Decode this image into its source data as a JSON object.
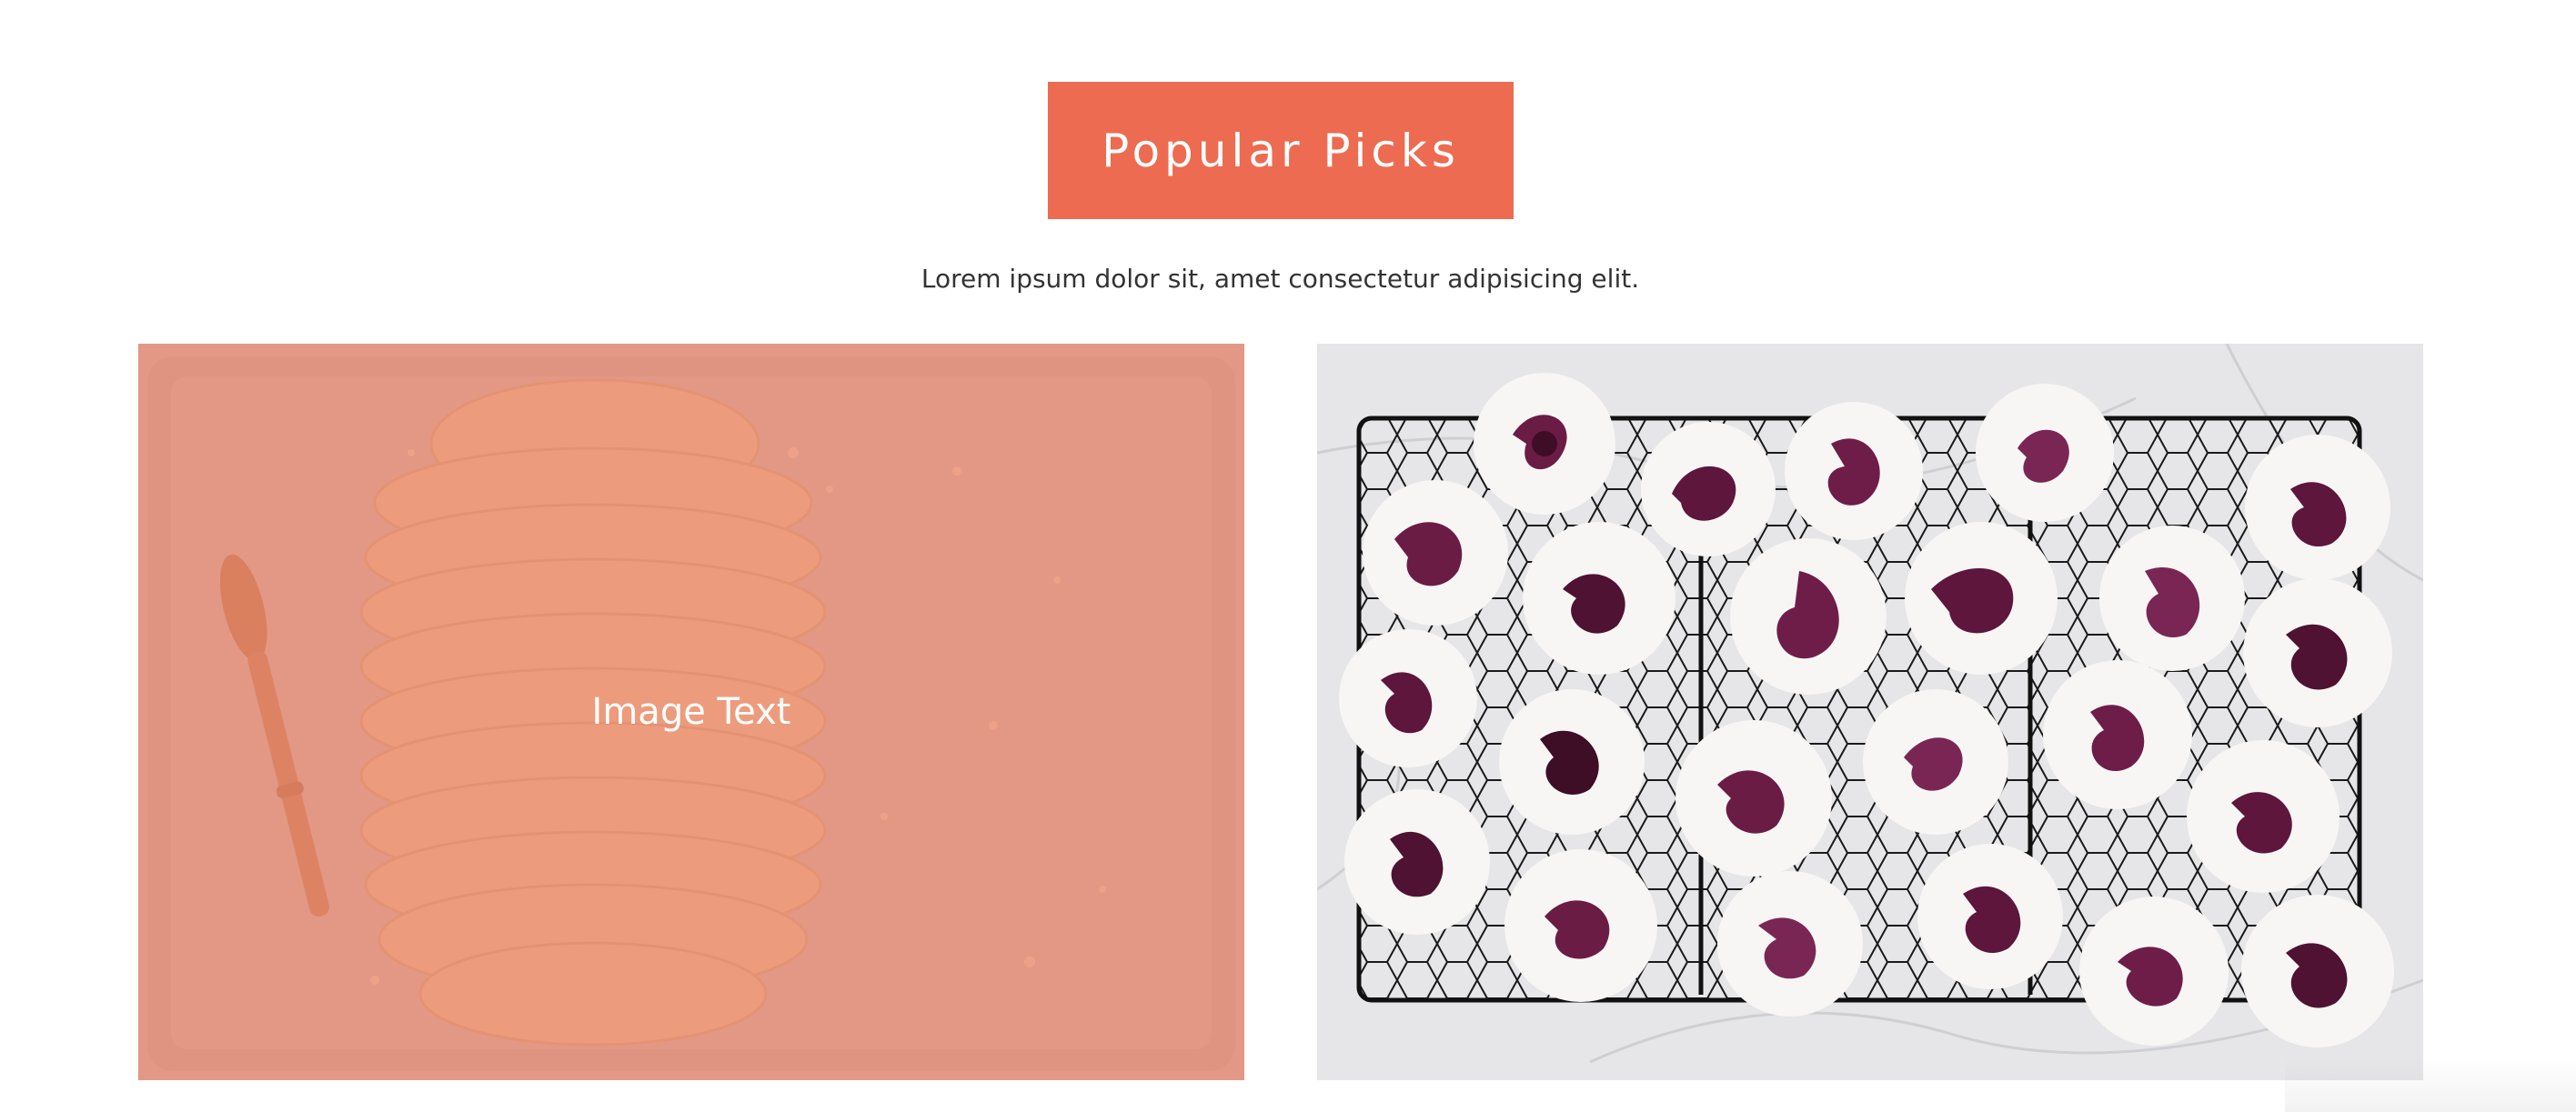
{
  "section": {
    "title": "Popular Picks",
    "description": "Lorem ipsum dolor sit, amet consectetur adipisicing elit."
  },
  "cards": [
    {
      "image_subject": "braided-bread-dough-on-baking-tray",
      "overlay_text": "Image Text"
    },
    {
      "image_subject": "swirled-meringues-on-cooling-rack"
    }
  ],
  "colors": {
    "accent": "#ed6b51",
    "text": "#333333",
    "background": "#ffffff"
  }
}
